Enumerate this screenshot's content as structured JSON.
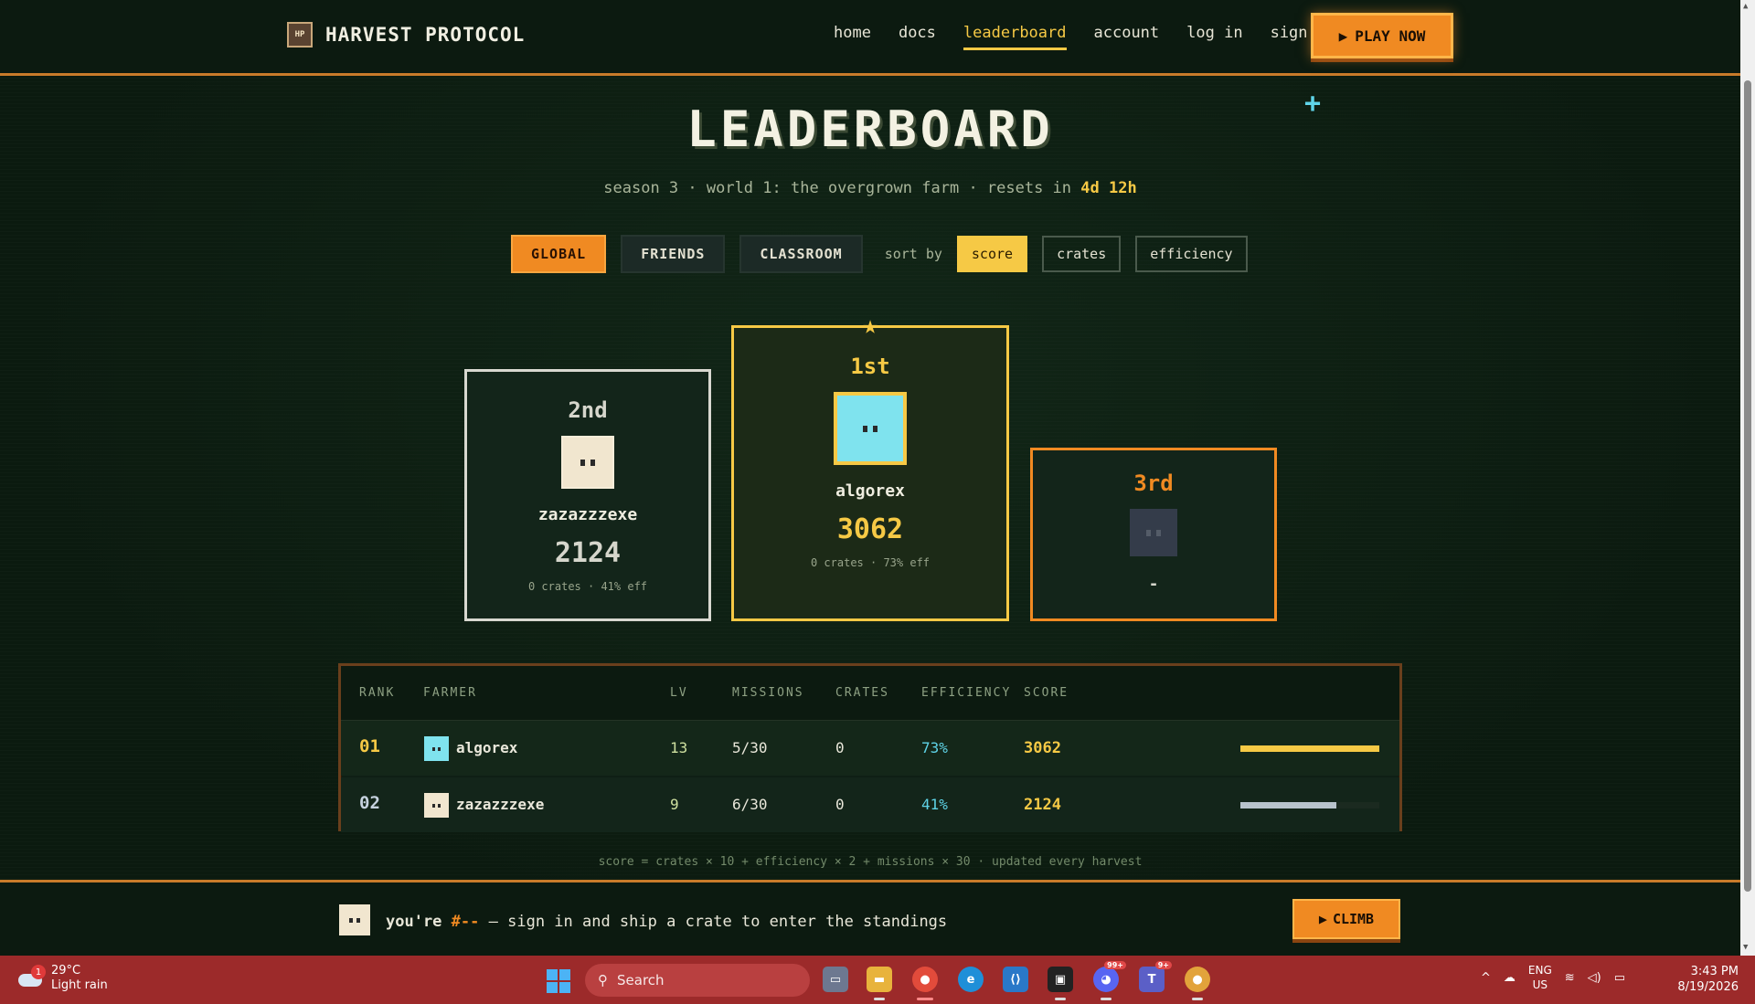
{
  "nav": {
    "logo_text": "HP",
    "brand": "HARVEST PROTOCOL",
    "links": [
      "home",
      "docs",
      "leaderboard",
      "account",
      "log in",
      "sign up"
    ],
    "play_label": "PLAY NOW"
  },
  "header": {
    "title": "LEADERBOARD",
    "subtitle_prefix": "season 3 · world 1: the overgrown farm · resets in",
    "resets_in": "4d 12h"
  },
  "filters": {
    "scopes": [
      "GLOBAL",
      "FRIENDS",
      "CLASSROOM"
    ],
    "sort_label": "sort by",
    "sorts": [
      "score",
      "crates",
      "efficiency"
    ]
  },
  "podium": {
    "second": {
      "place": "2nd",
      "name": "zazazzzexe",
      "score": "2124",
      "meta": "0 crates · 41% eff"
    },
    "first": {
      "place": "1st",
      "name": "algorex",
      "score": "3062",
      "meta": "0 crates · 73% eff"
    },
    "third": {
      "place": "3rd",
      "name": "-"
    }
  },
  "table": {
    "headers": [
      "RANK",
      "FARMER",
      "LV",
      "MISSIONS",
      "CRATES",
      "EFFICIENCY",
      "SCORE"
    ],
    "rows": [
      {
        "rank": "01",
        "farmer": "algorex",
        "lv": "13",
        "missions": "5/30",
        "crates": "0",
        "efficiency": "73%",
        "score": "3062",
        "score_fraction": 1.0
      },
      {
        "rank": "02",
        "farmer": "zazazzzexe",
        "lv": "9",
        "missions": "6/30",
        "crates": "0",
        "efficiency": "41%",
        "score": "2124",
        "score_fraction": 0.69
      }
    ]
  },
  "footnote": "score = crates × 10 + efficiency × 2 + missions × 30 · updated every harvest",
  "bottom": {
    "prefix": "you're",
    "rank": "#--",
    "suffix": "— sign in and ship a crate to enter the standings",
    "climb_label": "CLIMB"
  },
  "taskbar": {
    "weather_badge": "1",
    "temp": "29°C",
    "condition": "Light rain",
    "search_placeholder": "Search",
    "lang_top": "ENG",
    "lang_bottom": "US",
    "time": "3:43 PM",
    "date": "8/19/2026",
    "badge_a": "99+",
    "badge_b": "9+"
  },
  "colors": {
    "accent_orange": "#f08a22",
    "accent_gold": "#f6c945",
    "accent_cyan": "#5fd4e8",
    "background": "#0c1a10"
  },
  "icons": [
    "logo-icon",
    "play-icon",
    "star-icon",
    "plus-icon",
    "windows-start-icon",
    "search-icon",
    "file-explorer-icon",
    "chrome-icon",
    "edge-icon",
    "vscode-icon",
    "terminal-icon",
    "discord-icon",
    "teams-icon"
  ]
}
